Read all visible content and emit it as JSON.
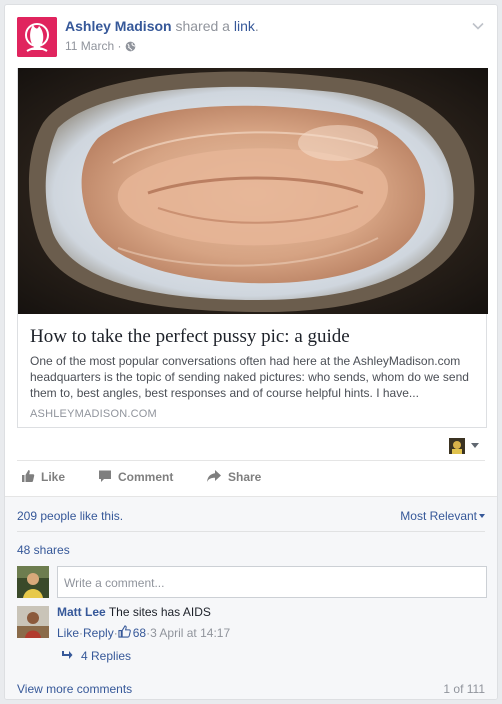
{
  "post": {
    "author": "Ashley Madison",
    "action_text": " shared a ",
    "link_word": "link",
    "period": ".",
    "date": "11 March",
    "separator": " · "
  },
  "link_preview": {
    "title": "How to take the perfect pussy pic: a guide",
    "description": "One of the most popular conversations often had here at the AshleyMadison.com headquarters is the topic of sending naked pictures: who sends, whom do we send them to, best angles, best responses and of course helpful hints. I have...",
    "domain": "ASHLEYMADISON.COM"
  },
  "actions": {
    "like": "Like",
    "comment": "Comment",
    "share": "Share"
  },
  "engagement": {
    "likes": "209 people like this.",
    "sort": "Most Relevant",
    "shares": "48 shares"
  },
  "comment_input": {
    "placeholder": "Write a comment..."
  },
  "comments": [
    {
      "author": "Matt Lee",
      "text": "The sites has AIDS",
      "like_label": "Like",
      "reply_label": "Reply",
      "like_count": "68",
      "time": "3 April at 14:17",
      "dot": " · "
    }
  ],
  "replies_label": "4 Replies",
  "footer": {
    "view_more": "View more comments",
    "count": "1 of 111"
  },
  "colors": {
    "brand_pink": "#e0245e",
    "link_blue": "#365899",
    "muted_gray": "#90949c"
  },
  "icons": [
    "ashley-madison-logo-icon",
    "globe-icon",
    "chevron-down-icon",
    "like-thumb-icon",
    "comment-bubble-icon",
    "share-arrow-icon",
    "reply-arrow-icon",
    "like-count-thumb-icon"
  ]
}
